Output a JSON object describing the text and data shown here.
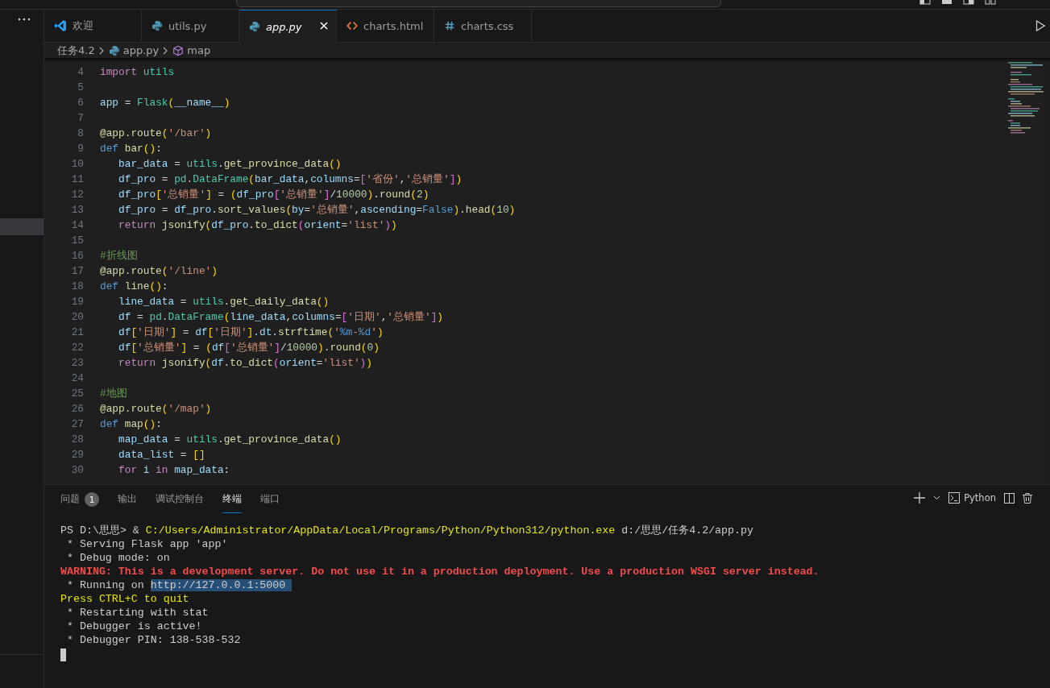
{
  "tabs": [
    {
      "label": "欢迎",
      "kind": "vscode",
      "selected": false
    },
    {
      "label": "utils.py",
      "kind": "python",
      "selected": false
    },
    {
      "label": "app.py",
      "kind": "python",
      "selected": true
    },
    {
      "label": "charts.html",
      "kind": "html",
      "selected": false
    },
    {
      "label": "charts.css",
      "kind": "css",
      "selected": false
    }
  ],
  "breadcrumb": [
    {
      "label": "任务4.2",
      "kind": "folder"
    },
    {
      "label": "app.py",
      "kind": "python"
    },
    {
      "label": "map",
      "kind": "symbol"
    }
  ],
  "code_lines": [
    {
      "number": "4",
      "tokens": [
        {
          "text": "import",
          "kind": "kw"
        },
        {
          "text": " utils",
          "kind": "cls"
        }
      ]
    },
    {
      "number": "5"
    },
    {
      "number": "6",
      "tokens": [
        {
          "text": "app",
          "kind": "var"
        },
        {
          "text": " = ",
          "kind": "op"
        },
        {
          "text": "Flask",
          "kind": "cls"
        },
        {
          "text": "(",
          "kind": "b1"
        },
        {
          "text": "__name__",
          "kind": "var"
        },
        {
          "text": ")",
          "kind": "b1"
        }
      ]
    },
    {
      "number": "7"
    },
    {
      "number": "8",
      "tokens": [
        {
          "text": "@app.route",
          "kind": "fn"
        },
        {
          "text": "(",
          "kind": "b1"
        },
        {
          "text": "'/bar'",
          "kind": "str"
        },
        {
          "text": ")",
          "kind": "b1"
        }
      ]
    },
    {
      "number": "9",
      "tokens": [
        {
          "text": "def",
          "kind": "def"
        },
        {
          "text": " bar",
          "kind": "fn"
        },
        {
          "text": "()",
          "kind": "b1"
        },
        {
          "text": ":",
          "kind": "op"
        }
      ]
    },
    {
      "number": "10",
      "tokens": [
        {
          "text": "   bar_data",
          "kind": "var"
        },
        {
          "text": " = ",
          "kind": "op"
        },
        {
          "text": "utils",
          "kind": "cls"
        },
        {
          "text": ".",
          "kind": "op"
        },
        {
          "text": "get_province_data",
          "kind": "fn"
        },
        {
          "text": "()",
          "kind": "b1"
        }
      ]
    },
    {
      "number": "11",
      "tokens": [
        {
          "text": "   df_pro",
          "kind": "var"
        },
        {
          "text": " = ",
          "kind": "op"
        },
        {
          "text": "pd",
          "kind": "cls"
        },
        {
          "text": ".",
          "kind": "op"
        },
        {
          "text": "DataFrame",
          "kind": "cls"
        },
        {
          "text": "(",
          "kind": "b1"
        },
        {
          "text": "bar_data",
          "kind": "var"
        },
        {
          "text": ",",
          "kind": "op"
        },
        {
          "text": "columns",
          "kind": "var"
        },
        {
          "text": "=",
          "kind": "op"
        },
        {
          "text": "[",
          "kind": "b2"
        },
        {
          "text": "'省份'",
          "kind": "str"
        },
        {
          "text": ",",
          "kind": "op"
        },
        {
          "text": "'总销量'",
          "kind": "str"
        },
        {
          "text": "]",
          "kind": "b2"
        },
        {
          "text": ")",
          "kind": "b1"
        }
      ]
    },
    {
      "number": "12",
      "tokens": [
        {
          "text": "   df_pro",
          "kind": "var"
        },
        {
          "text": "[",
          "kind": "b1"
        },
        {
          "text": "'总销量'",
          "kind": "str"
        },
        {
          "text": "]",
          "kind": "b1"
        },
        {
          "text": " = ",
          "kind": "op"
        },
        {
          "text": "(",
          "kind": "b1"
        },
        {
          "text": "df_pro",
          "kind": "var"
        },
        {
          "text": "[",
          "kind": "b2"
        },
        {
          "text": "'总销量'",
          "kind": "str"
        },
        {
          "text": "]",
          "kind": "b2"
        },
        {
          "text": "/",
          "kind": "op"
        },
        {
          "text": "10000",
          "kind": "num"
        },
        {
          "text": ")",
          "kind": "b1"
        },
        {
          "text": ".",
          "kind": "op"
        },
        {
          "text": "round",
          "kind": "fn"
        },
        {
          "text": "(",
          "kind": "b1"
        },
        {
          "text": "2",
          "kind": "num"
        },
        {
          "text": ")",
          "kind": "b1"
        }
      ]
    },
    {
      "number": "13",
      "tokens": [
        {
          "text": "   df_pro",
          "kind": "var"
        },
        {
          "text": " = ",
          "kind": "op"
        },
        {
          "text": "df_pro",
          "kind": "var"
        },
        {
          "text": ".",
          "kind": "op"
        },
        {
          "text": "sort_values",
          "kind": "fn"
        },
        {
          "text": "(",
          "kind": "b1"
        },
        {
          "text": "by",
          "kind": "var"
        },
        {
          "text": "=",
          "kind": "op"
        },
        {
          "text": "'总销量'",
          "kind": "str"
        },
        {
          "text": ",",
          "kind": "op"
        },
        {
          "text": "ascending",
          "kind": "var"
        },
        {
          "text": "=",
          "kind": "op"
        },
        {
          "text": "False",
          "kind": "def"
        },
        {
          "text": ")",
          "kind": "b1"
        },
        {
          "text": ".",
          "kind": "op"
        },
        {
          "text": "head",
          "kind": "fn"
        },
        {
          "text": "(",
          "kind": "b1"
        },
        {
          "text": "10",
          "kind": "num"
        },
        {
          "text": ")",
          "kind": "b1"
        }
      ]
    },
    {
      "number": "14",
      "tokens": [
        {
          "text": "   return",
          "kind": "kw"
        },
        {
          "text": " jsonify",
          "kind": "fn"
        },
        {
          "text": "(",
          "kind": "b1"
        },
        {
          "text": "df_pro",
          "kind": "var"
        },
        {
          "text": ".",
          "kind": "op"
        },
        {
          "text": "to_dict",
          "kind": "fn"
        },
        {
          "text": "(",
          "kind": "b2"
        },
        {
          "text": "orient",
          "kind": "var"
        },
        {
          "text": "=",
          "kind": "op"
        },
        {
          "text": "'list'",
          "kind": "str"
        },
        {
          "text": ")",
          "kind": "b2"
        },
        {
          "text": ")",
          "kind": "b1"
        }
      ]
    },
    {
      "number": "15"
    },
    {
      "number": "16",
      "tokens": [
        {
          "text": "#折线图",
          "kind": "comment"
        }
      ]
    },
    {
      "number": "17",
      "tokens": [
        {
          "text": "@app.route",
          "kind": "fn"
        },
        {
          "text": "(",
          "kind": "b1"
        },
        {
          "text": "'/line'",
          "kind": "str"
        },
        {
          "text": ")",
          "kind": "b1"
        }
      ]
    },
    {
      "number": "18",
      "tokens": [
        {
          "text": "def",
          "kind": "def"
        },
        {
          "text": " line",
          "kind": "fn"
        },
        {
          "text": "()",
          "kind": "b1"
        },
        {
          "text": ":",
          "kind": "op"
        }
      ]
    },
    {
      "number": "19",
      "tokens": [
        {
          "text": "   line_data",
          "kind": "var"
        },
        {
          "text": " = ",
          "kind": "op"
        },
        {
          "text": "utils",
          "kind": "cls"
        },
        {
          "text": ".",
          "kind": "op"
        },
        {
          "text": "get_daily_data",
          "kind": "fn"
        },
        {
          "text": "()",
          "kind": "b1"
        }
      ]
    },
    {
      "number": "20",
      "tokens": [
        {
          "text": "   df",
          "kind": "var"
        },
        {
          "text": " = ",
          "kind": "op"
        },
        {
          "text": "pd",
          "kind": "cls"
        },
        {
          "text": ".",
          "kind": "op"
        },
        {
          "text": "DataFrame",
          "kind": "cls"
        },
        {
          "text": "(",
          "kind": "b1"
        },
        {
          "text": "line_data",
          "kind": "var"
        },
        {
          "text": ",",
          "kind": "op"
        },
        {
          "text": "columns",
          "kind": "var"
        },
        {
          "text": "=",
          "kind": "op"
        },
        {
          "text": "[",
          "kind": "b2"
        },
        {
          "text": "'日期'",
          "kind": "str"
        },
        {
          "text": ",",
          "kind": "op"
        },
        {
          "text": "'总销量'",
          "kind": "str"
        },
        {
          "text": "]",
          "kind": "b2"
        },
        {
          "text": ")",
          "kind": "b1"
        }
      ]
    },
    {
      "number": "21",
      "tokens": [
        {
          "text": "   df",
          "kind": "var"
        },
        {
          "text": "[",
          "kind": "b1"
        },
        {
          "text": "'日期'",
          "kind": "str"
        },
        {
          "text": "]",
          "kind": "b1"
        },
        {
          "text": " = ",
          "kind": "op"
        },
        {
          "text": "df",
          "kind": "var"
        },
        {
          "text": "[",
          "kind": "b1"
        },
        {
          "text": "'日期'",
          "kind": "str"
        },
        {
          "text": "]",
          "kind": "b1"
        },
        {
          "text": ".dt.",
          "kind": "var"
        },
        {
          "text": "strftime",
          "kind": "fn"
        },
        {
          "text": "(",
          "kind": "b1"
        },
        {
          "text": "'",
          "kind": "str"
        },
        {
          "text": "%m",
          "kind": "def"
        },
        {
          "text": "-",
          "kind": "str"
        },
        {
          "text": "%d",
          "kind": "def"
        },
        {
          "text": "'",
          "kind": "str"
        },
        {
          "text": ")",
          "kind": "b1"
        }
      ]
    },
    {
      "number": "22",
      "tokens": [
        {
          "text": "   df",
          "kind": "var"
        },
        {
          "text": "[",
          "kind": "b1"
        },
        {
          "text": "'总销量'",
          "kind": "str"
        },
        {
          "text": "]",
          "kind": "b1"
        },
        {
          "text": " = ",
          "kind": "op"
        },
        {
          "text": "(",
          "kind": "b1"
        },
        {
          "text": "df",
          "kind": "var"
        },
        {
          "text": "[",
          "kind": "b2"
        },
        {
          "text": "'总销量'",
          "kind": "str"
        },
        {
          "text": "]",
          "kind": "b2"
        },
        {
          "text": "/",
          "kind": "op"
        },
        {
          "text": "10000",
          "kind": "num"
        },
        {
          "text": ")",
          "kind": "b1"
        },
        {
          "text": ".",
          "kind": "op"
        },
        {
          "text": "round",
          "kind": "fn"
        },
        {
          "text": "(",
          "kind": "b1"
        },
        {
          "text": "0",
          "kind": "num"
        },
        {
          "text": ")",
          "kind": "b1"
        }
      ]
    },
    {
      "number": "23",
      "tokens": [
        {
          "text": "   return",
          "kind": "kw"
        },
        {
          "text": " jsonify",
          "kind": "fn"
        },
        {
          "text": "(",
          "kind": "b1"
        },
        {
          "text": "df",
          "kind": "var"
        },
        {
          "text": ".",
          "kind": "op"
        },
        {
          "text": "to_dict",
          "kind": "fn"
        },
        {
          "text": "(",
          "kind": "b2"
        },
        {
          "text": "orient",
          "kind": "var"
        },
        {
          "text": "=",
          "kind": "op"
        },
        {
          "text": "'list'",
          "kind": "str"
        },
        {
          "text": ")",
          "kind": "b2"
        },
        {
          "text": ")",
          "kind": "b1"
        }
      ]
    },
    {
      "number": "24"
    },
    {
      "number": "25",
      "tokens": [
        {
          "text": "#地图",
          "kind": "comment"
        }
      ]
    },
    {
      "number": "26",
      "tokens": [
        {
          "text": "@app.route",
          "kind": "fn"
        },
        {
          "text": "(",
          "kind": "b1"
        },
        {
          "text": "'/map'",
          "kind": "str"
        },
        {
          "text": ")",
          "kind": "b1"
        }
      ]
    },
    {
      "number": "27",
      "tokens": [
        {
          "text": "def",
          "kind": "def"
        },
        {
          "text": " map",
          "kind": "fn"
        },
        {
          "text": "()",
          "kind": "b1"
        },
        {
          "text": ":",
          "kind": "op"
        }
      ]
    },
    {
      "number": "28",
      "tokens": [
        {
          "text": "   map_data",
          "kind": "var"
        },
        {
          "text": " = ",
          "kind": "op"
        },
        {
          "text": "utils",
          "kind": "cls"
        },
        {
          "text": ".",
          "kind": "op"
        },
        {
          "text": "get_province_data",
          "kind": "fn"
        },
        {
          "text": "()",
          "kind": "b1"
        }
      ]
    },
    {
      "number": "29",
      "tokens": [
        {
          "text": "   data_list",
          "kind": "var"
        },
        {
          "text": " = ",
          "kind": "op"
        },
        {
          "text": "[]",
          "kind": "b1"
        }
      ]
    },
    {
      "number": "30",
      "tokens": [
        {
          "text": "   for",
          "kind": "kw"
        },
        {
          "text": " i",
          "kind": "var"
        },
        {
          "text": " in",
          "kind": "kw"
        },
        {
          "text": " map_data",
          "kind": "var"
        },
        {
          "text": ":",
          "kind": "op"
        }
      ]
    }
  ],
  "panel": {
    "tabs": [
      {
        "label": "问题",
        "badge": "1",
        "selected": false
      },
      {
        "label": "输出",
        "selected": false
      },
      {
        "label": "调试控制台",
        "selected": false
      },
      {
        "label": "终端",
        "selected": true
      },
      {
        "label": "端口",
        "selected": false
      }
    ],
    "shell": "Python",
    "terminal_lines": [
      [
        {
          "text": "PS D:\\思思> & ",
          "kind": "plain"
        },
        {
          "text": "C:/Users/Administrator/AppData/Local/Programs/Python/Python312/python.exe",
          "kind": "path"
        },
        {
          "text": " d:/思思/任务4.2/app.py",
          "kind": "plain"
        }
      ],
      [
        {
          "text": " * Serving Flask app 'app'",
          "kind": "plain"
        }
      ],
      [
        {
          "text": " * Debug mode: on",
          "kind": "plain"
        }
      ],
      [
        {
          "text": "WARNING: This is a development server. Do not use it in a production deployment. Use a production WSGI server instead.",
          "kind": "error"
        }
      ],
      [
        {
          "text": " * Running on ",
          "kind": "plain"
        },
        {
          "text": "http://127.0.0.1:5000 ",
          "kind": "selection"
        }
      ],
      [
        {
          "text": "Press CTRL+C to quit",
          "kind": "path"
        }
      ],
      [
        {
          "text": " * Restarting with stat",
          "kind": "plain"
        }
      ],
      [
        {
          "text": " * Debugger is active!",
          "kind": "plain"
        }
      ],
      [
        {
          "text": " * Debugger PIN: 138-538-532",
          "kind": "plain"
        }
      ]
    ]
  }
}
